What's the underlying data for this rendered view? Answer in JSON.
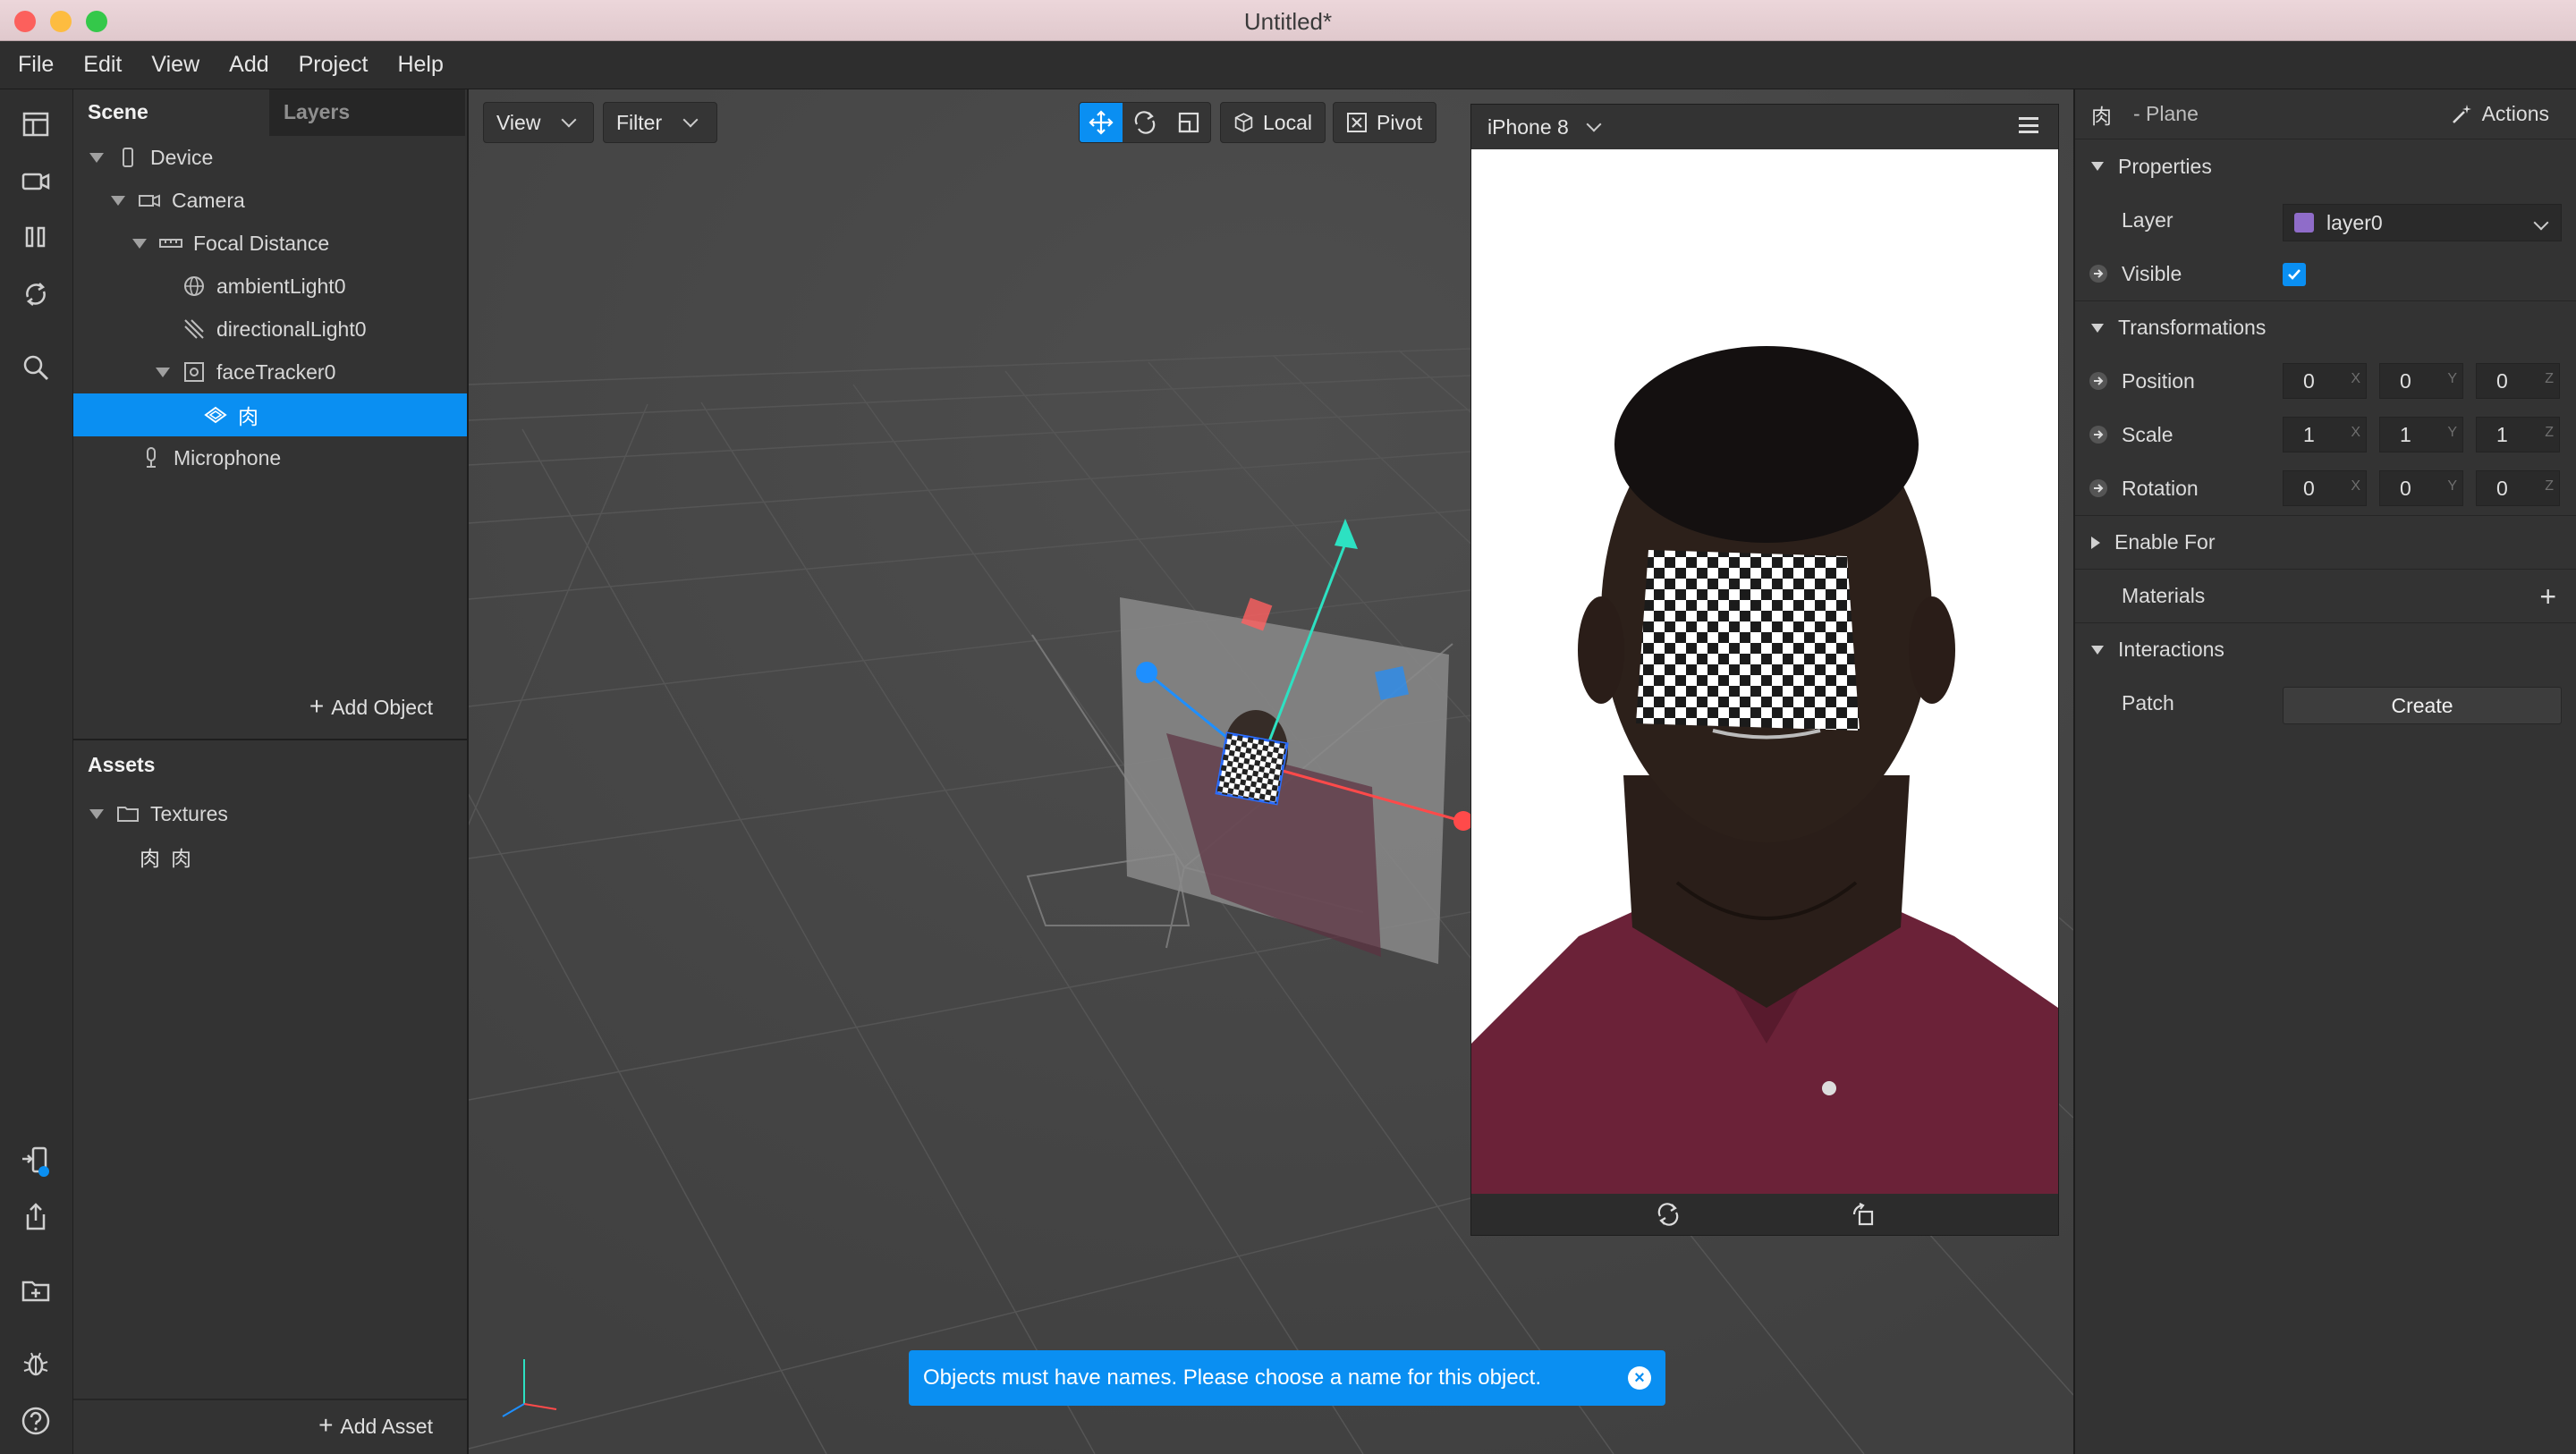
{
  "window": {
    "title": "Untitled*"
  },
  "menu": [
    "File",
    "Edit",
    "View",
    "Add",
    "Project",
    "Help"
  ],
  "scene": {
    "tabs": [
      "Scene",
      "Layers"
    ],
    "tree": [
      {
        "label": "Device",
        "icon": "phone-icon"
      },
      {
        "label": "Camera",
        "icon": "camera-icon"
      },
      {
        "label": "Focal Distance",
        "icon": "ruler-icon"
      },
      {
        "label": "ambientLight0",
        "icon": "globe-icon"
      },
      {
        "label": "directionalLight0",
        "icon": "directional-light-icon"
      },
      {
        "label": "faceTracker0",
        "icon": "face-tracker-icon"
      },
      {
        "label": "肉",
        "icon": "plane-icon"
      },
      {
        "label": "Microphone",
        "icon": "microphone-icon"
      }
    ],
    "add_object": "Add Object"
  },
  "assets": {
    "title": "Assets",
    "items": [
      {
        "label": "Textures",
        "icon": "folder-icon"
      },
      {
        "label": "肉",
        "thumb": "肉"
      }
    ],
    "add_asset": "Add Asset"
  },
  "viewport": {
    "view_label": "View",
    "filter_label": "Filter",
    "local_label": "Local",
    "pivot_label": "Pivot"
  },
  "preview": {
    "device": "iPhone 8"
  },
  "toast": {
    "message": "Objects must have names. Please choose a name for this object.",
    "close": "×"
  },
  "inspector": {
    "object_glyph": "肉",
    "object_type": "- Plane",
    "actions_label": "Actions",
    "properties_label": "Properties",
    "layer_label": "Layer",
    "layer_value": "layer0",
    "layer_color": "#8f6cc9",
    "visible_label": "Visible",
    "transformations_label": "Transformations",
    "position": {
      "label": "Position",
      "x": "0",
      "y": "0",
      "z": "0"
    },
    "scale": {
      "label": "Scale",
      "x": "1",
      "y": "1",
      "z": "1"
    },
    "rotation": {
      "label": "Rotation",
      "x": "0",
      "y": "0",
      "z": "0"
    },
    "axes": [
      "X",
      "Y",
      "Z"
    ],
    "enable_for_label": "Enable For",
    "materials_label": "Materials",
    "materials_add": "+",
    "interactions_label": "Interactions",
    "patch_label": "Patch",
    "create_label": "Create"
  },
  "colors": {
    "accent": "#0a8ff2",
    "panel": "#333333",
    "viewport": "#444444"
  }
}
